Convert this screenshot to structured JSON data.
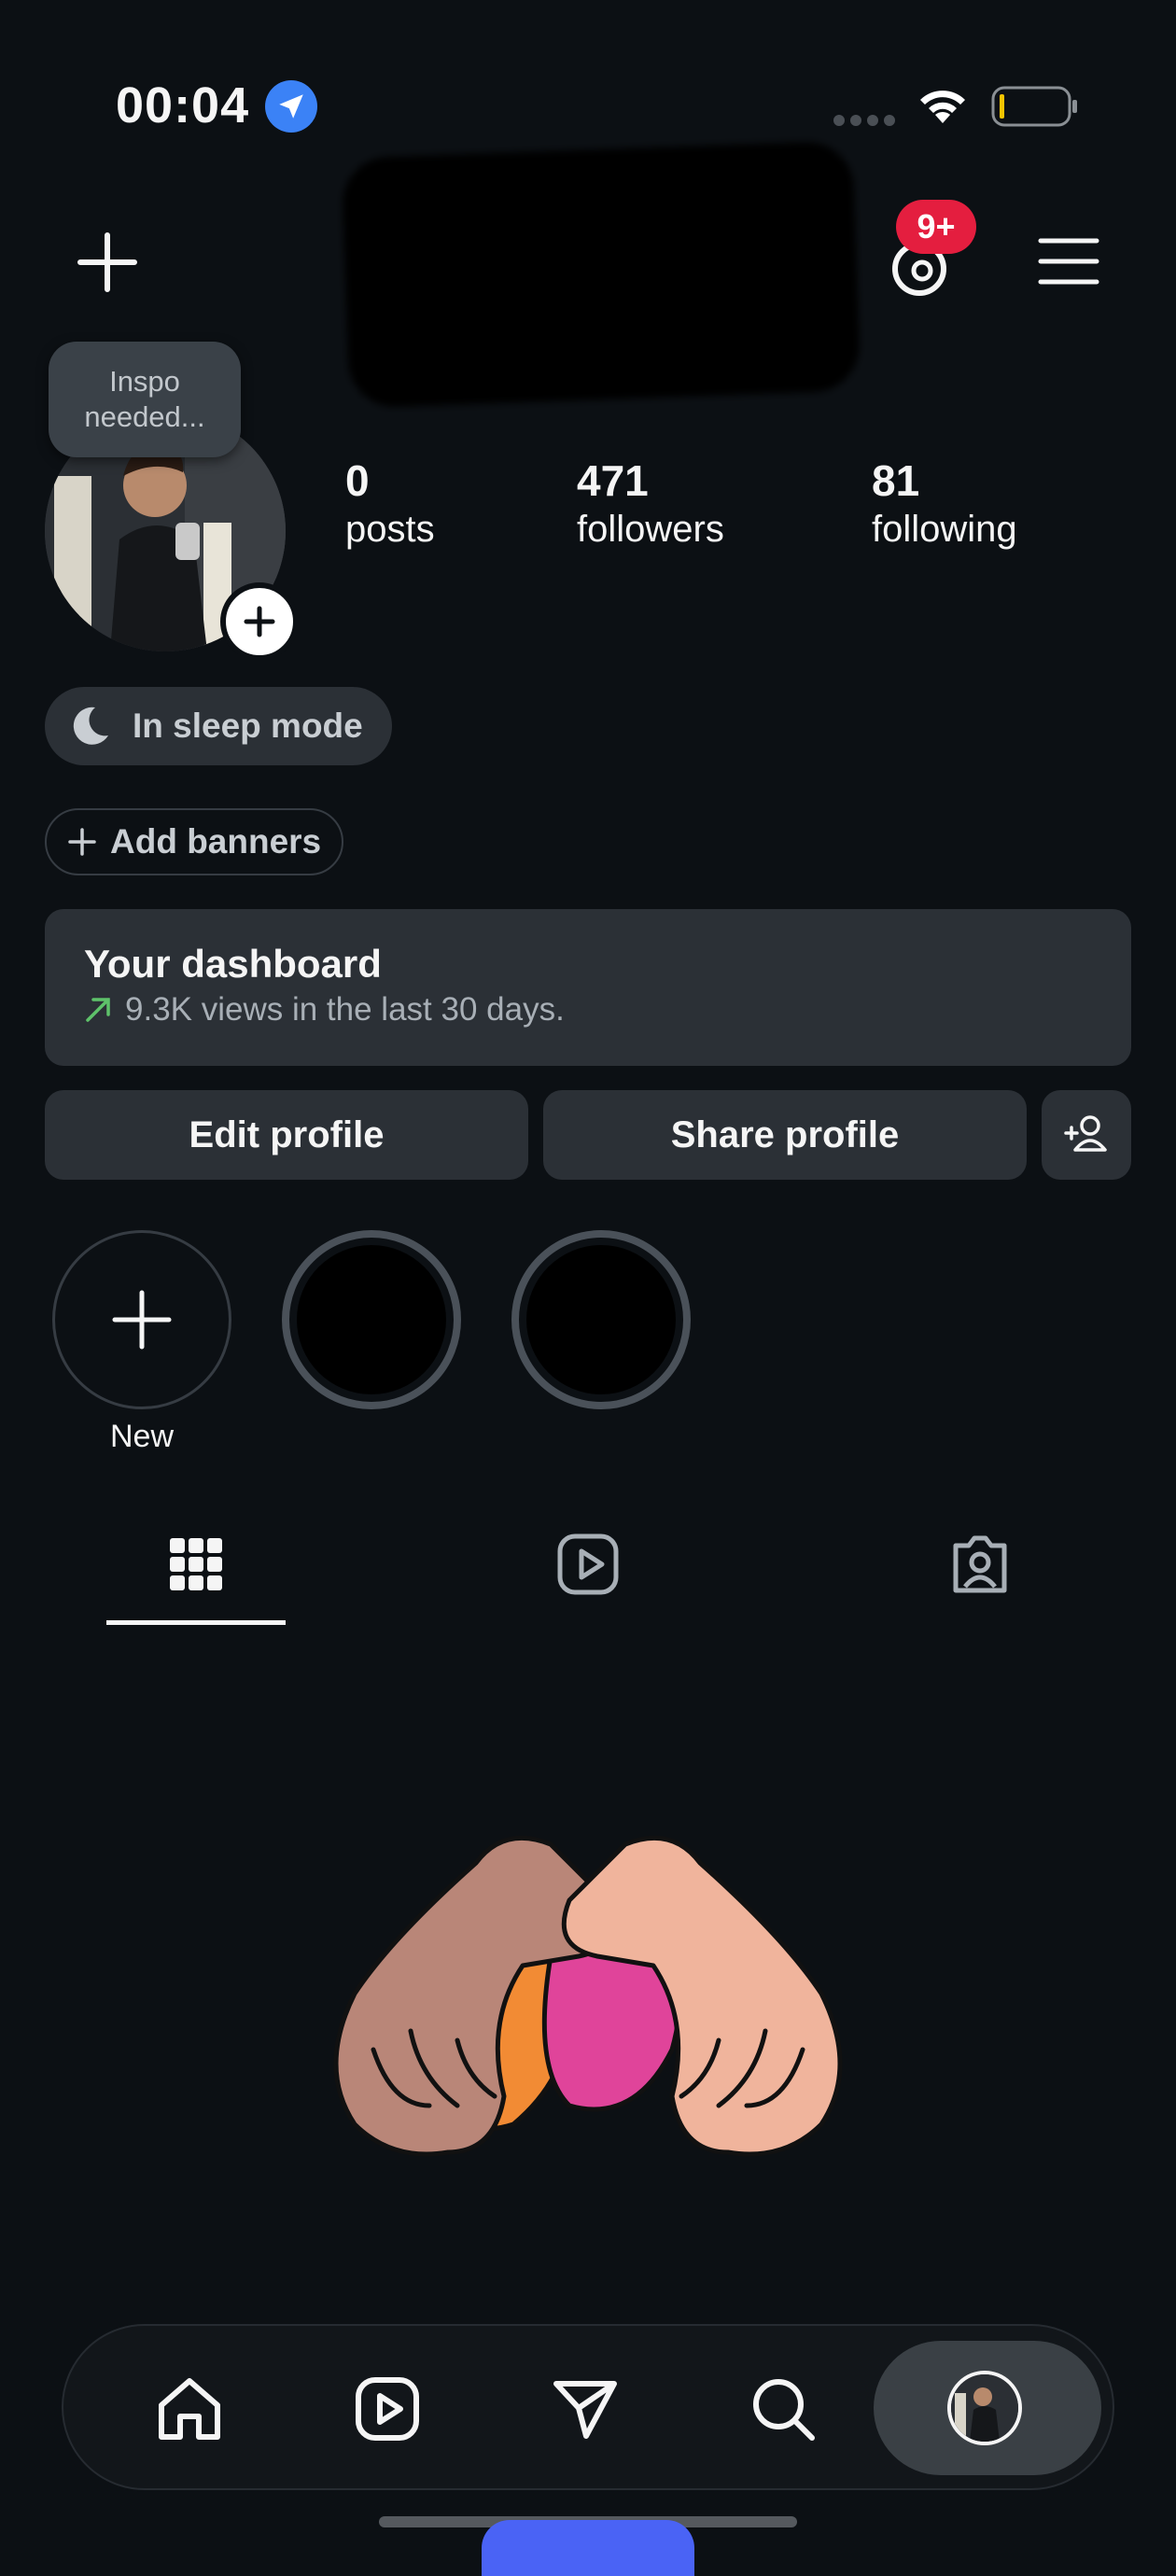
{
  "status_bar": {
    "time": "00:04"
  },
  "header": {
    "notification_badge": "9+"
  },
  "note": {
    "line1": "Inspo",
    "line2": "needed..."
  },
  "stats": [
    {
      "value": "0",
      "label": "posts"
    },
    {
      "value": "471",
      "label": "followers"
    },
    {
      "value": "81",
      "label": "following"
    }
  ],
  "status_pill": {
    "label": "In sleep mode"
  },
  "banners": {
    "label": "Add banners"
  },
  "dashboard": {
    "title": "Your dashboard",
    "subtitle": "9.3K views in the last 30 days.",
    "trend_color": "#5ec26a"
  },
  "actions": {
    "edit": "Edit profile",
    "share": "Share profile"
  },
  "highlights": {
    "new_label": "New"
  },
  "tabs": [
    "grid-icon",
    "reels-icon",
    "tagged-icon"
  ],
  "bottom_nav": [
    "home-icon",
    "reels-icon",
    "messages-icon",
    "search-icon",
    "profile-avatar"
  ],
  "colors": {
    "background": "#0c1014",
    "surface": "#2b3036",
    "badge": "#e41e3f",
    "location": "#3b82f6"
  }
}
